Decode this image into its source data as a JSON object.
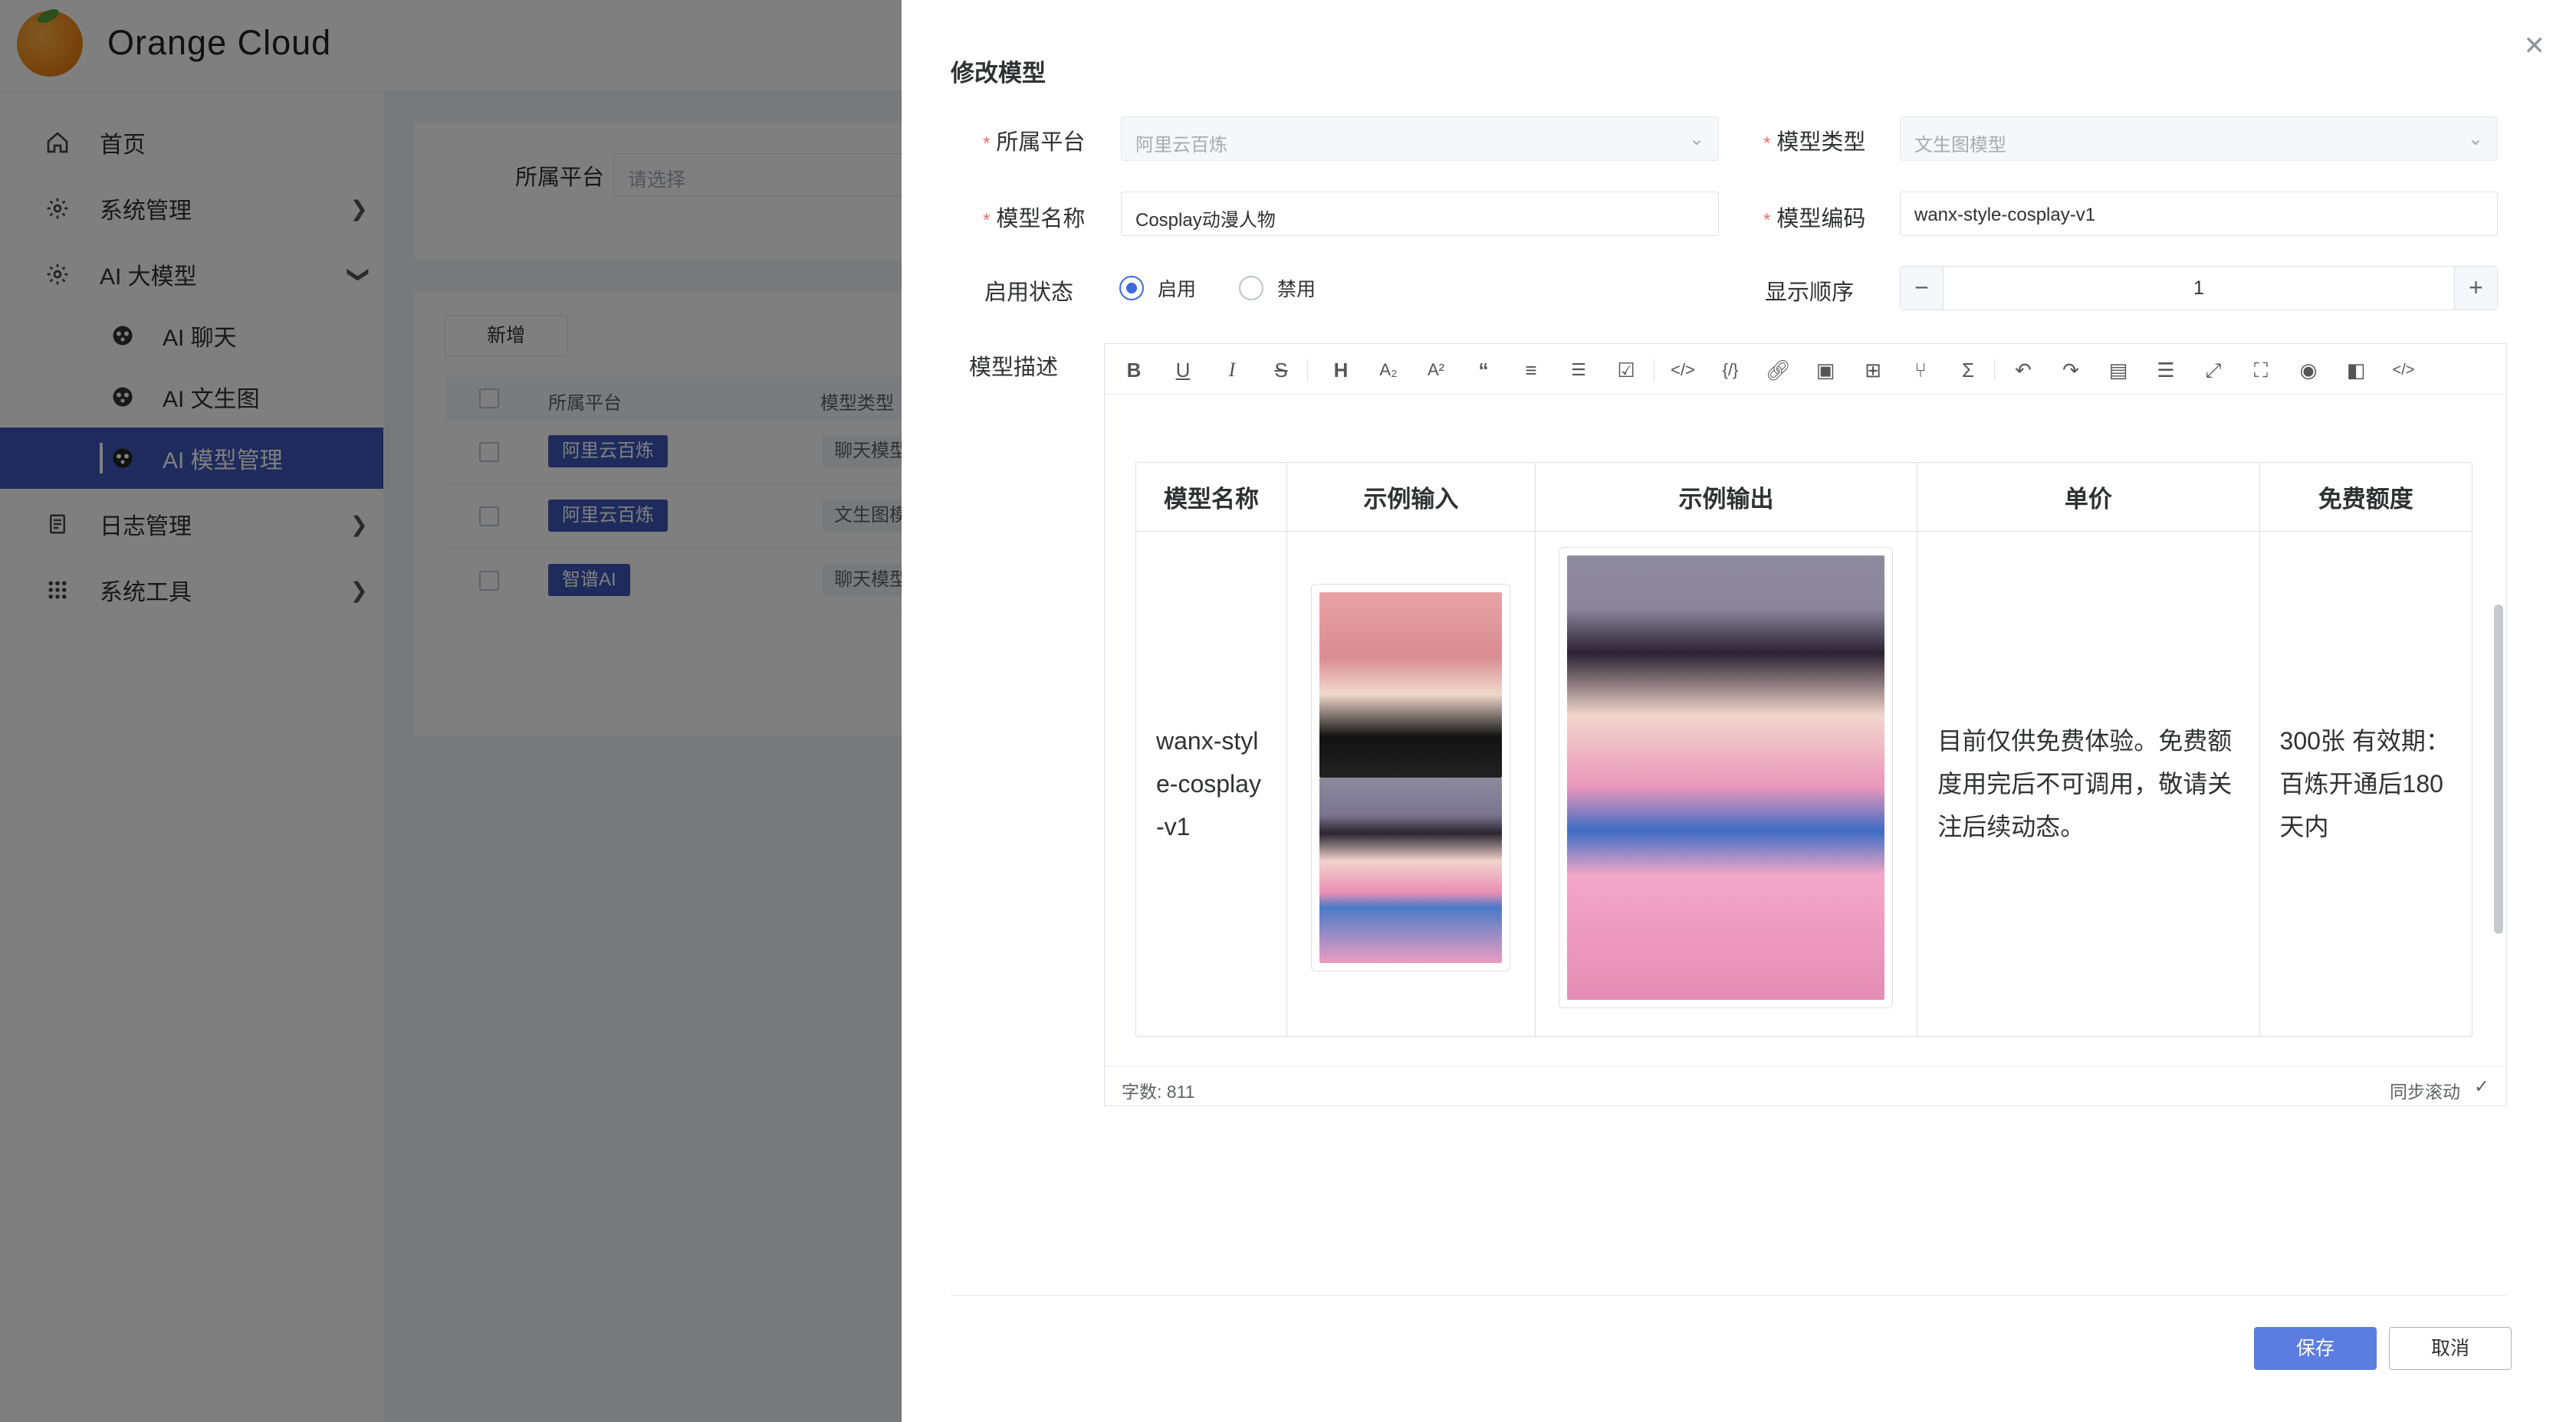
{
  "app": {
    "title": "Orange Cloud"
  },
  "sidebar": {
    "items": [
      {
        "label": "首页",
        "icon": "home-icon"
      },
      {
        "label": "系统管理",
        "icon": "gear-icon"
      },
      {
        "label": "AI 大模型",
        "icon": "gear-icon"
      },
      {
        "label": "AI 聊天",
        "icon": "ai-icon"
      },
      {
        "label": "AI 文生图",
        "icon": "ai-icon"
      },
      {
        "label": "AI 模型管理",
        "icon": "ai-icon"
      },
      {
        "label": "日志管理",
        "icon": "document-icon"
      },
      {
        "label": "系统工具",
        "icon": "grid-icon"
      }
    ]
  },
  "background_page": {
    "filter": {
      "label": "所属平台",
      "placeholder": "请选择"
    },
    "add_button": "新增",
    "columns": [
      "所属平台",
      "模型类型"
    ],
    "rows": [
      {
        "platform": "阿里云百炼",
        "type": "聊天模型"
      },
      {
        "platform": "阿里云百炼",
        "type": "文生图模型"
      },
      {
        "platform": "智谱AI",
        "type": "聊天模型"
      }
    ]
  },
  "drawer": {
    "title": "修改模型",
    "fields": {
      "platform": {
        "label": "所属平台",
        "value": "阿里云百炼"
      },
      "model_type": {
        "label": "模型类型",
        "value": "文生图模型"
      },
      "model_name": {
        "label": "模型名称",
        "value": "Cosplay动漫人物"
      },
      "model_code": {
        "label": "模型编码",
        "value": "wanx-style-cosplay-v1"
      },
      "status": {
        "label": "启用状态",
        "options": [
          "启用",
          "禁用"
        ],
        "selected": "启用"
      },
      "order": {
        "label": "显示顺序",
        "value": "1"
      },
      "description": {
        "label": "模型描述"
      }
    },
    "editor": {
      "table": {
        "headers": [
          "模型名称",
          "示例输入",
          "示例输出",
          "单价",
          "免费额度"
        ],
        "row": {
          "name": "wanx-style-cosplay-v1",
          "price": "目前仅供免费体验。免费额度用完后不可调用，敬请关注后续动态。",
          "quota": "300张 有效期：百炼开通后180天内"
        }
      },
      "word_count_label": "字数: 811",
      "sync_scroll_label": "同步滚动"
    },
    "buttons": {
      "save": "保存",
      "cancel": "取消"
    }
  }
}
